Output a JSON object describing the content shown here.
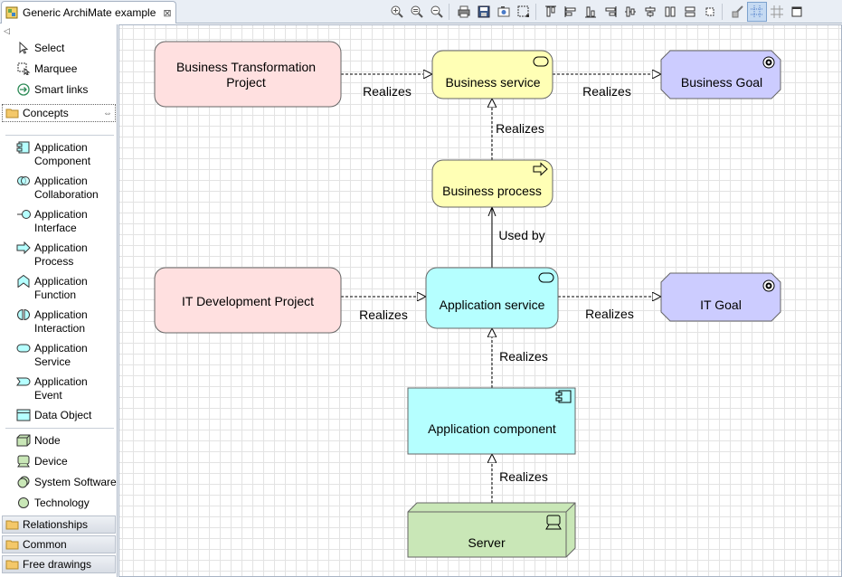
{
  "editor": {
    "tab_title": "Generic ArchiMate example",
    "close_glyph": "⊠"
  },
  "toolbar": {
    "buttons": [
      "zoom-in-icon",
      "zoom-normal-icon",
      "zoom-out-icon",
      "print-icon",
      "save-icon",
      "export-image-icon",
      "select-all-icon",
      "align-top-icon",
      "align-left-icon",
      "align-bottom-icon",
      "align-right-icon",
      "align-middle-icon",
      "align-center-icon",
      "match-height-icon",
      "match-width-icon",
      "default-size-icon",
      "format-painter-icon",
      "grid-icon",
      "snap-to-grid-icon",
      "maximize-icon"
    ]
  },
  "palette": {
    "tools": [
      {
        "label": "Select",
        "icon": "arrow-pointer-icon"
      },
      {
        "label": "Marquee",
        "icon": "marquee-icon"
      },
      {
        "label": "Smart links",
        "icon": "smart-connection-icon"
      }
    ],
    "concepts_drawer": "Concepts",
    "application_items": [
      {
        "line1": "Application",
        "line2": "Component",
        "icon": "component-icon"
      },
      {
        "line1": "Application",
        "line2": "Collaboration",
        "icon": "collaboration-icon"
      },
      {
        "line1": "Application",
        "line2": "Interface",
        "icon": "interface-icon"
      },
      {
        "line1": "Application",
        "line2": "Process",
        "icon": "process-arrow-icon"
      },
      {
        "line1": "Application",
        "line2": "Function",
        "icon": "function-icon"
      },
      {
        "line1": "Application",
        "line2": "Interaction",
        "icon": "interaction-icon"
      },
      {
        "line1": "Application",
        "line2": "Service",
        "icon": "service-icon"
      },
      {
        "line1": "Application",
        "line2": "Event",
        "icon": "event-icon"
      },
      {
        "line1": "Data Object",
        "line2": "",
        "icon": "data-object-icon"
      }
    ],
    "technology_items": [
      {
        "label": "Node",
        "icon": "node-icon"
      },
      {
        "label": "Device",
        "icon": "device-icon"
      },
      {
        "label": "System Software",
        "icon": "system-software-icon"
      },
      {
        "label": "Technology",
        "icon": "technology-icon"
      }
    ],
    "drawers": [
      "Relationships",
      "Common",
      "Free drawings"
    ]
  },
  "diagram": {
    "nodes": {
      "btp": {
        "label1": "Business Transformation",
        "label2": "Project"
      },
      "bs": {
        "label": "Business service"
      },
      "bg": {
        "label": "Business Goal"
      },
      "bp": {
        "label": "Business process"
      },
      "itdp": {
        "label": "IT Development Project"
      },
      "as": {
        "label": "Application service"
      },
      "itg": {
        "label": "IT Goal"
      },
      "ac": {
        "label": "Application component"
      },
      "srv": {
        "label": "Server"
      }
    },
    "relations": {
      "btp_bs": "Realizes",
      "bs_bg": "Realizes",
      "bp_bs": "Realizes",
      "as_bp": "Used by",
      "itdp_as": "Realizes",
      "as_itg": "Realizes",
      "ac_as": "Realizes",
      "srv_ac": "Realizes"
    },
    "colors": {
      "project": "#ffe0e0",
      "business": "#ffffb5",
      "goal": "#ccccff",
      "application": "#b5ffff",
      "technology": "#c9e7b7"
    }
  }
}
